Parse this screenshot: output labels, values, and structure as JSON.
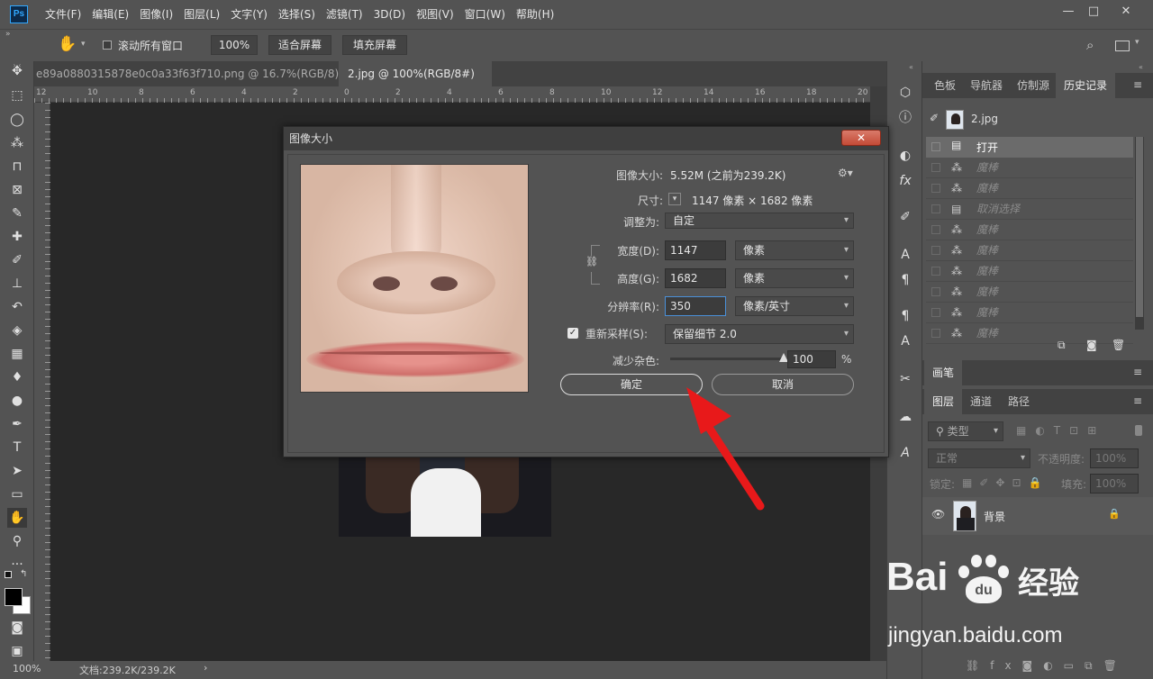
{
  "app": {
    "logo": "Ps"
  },
  "menu": {
    "items": [
      "文件(F)",
      "编辑(E)",
      "图像(I)",
      "图层(L)",
      "文字(Y)",
      "选择(S)",
      "滤镜(T)",
      "3D(D)",
      "视图(V)",
      "窗口(W)",
      "帮助(H)"
    ]
  },
  "window_controls": {
    "minimize": "—",
    "maximize": "□",
    "close": "✕"
  },
  "options": {
    "scroll_all_label": "滚动所有窗口",
    "zoom_label": "100%",
    "fit_screen_label": "适合屏幕",
    "fill_screen_label": "填充屏幕"
  },
  "tabs": [
    {
      "label": "e89a0880315878e0c0a33f63f710.png @ 16.7%(RGB/8) *",
      "close": "✕"
    },
    {
      "label": "2.jpg @ 100%(RGB/8#) *",
      "close": "✕"
    }
  ],
  "ruler_ticks": [
    "12",
    "10",
    "8",
    "6",
    "4",
    "2",
    "0",
    "2",
    "4",
    "6",
    "8",
    "10",
    "12",
    "14",
    "16",
    "18",
    "20"
  ],
  "status": {
    "zoom": "100%",
    "doc": "文档:239.2K/239.2K",
    "arrow": "›"
  },
  "panels": {
    "tabs": [
      "色板",
      "导航器",
      "仿制源",
      "历史记录"
    ],
    "history_snapshot": "2.jpg",
    "history": [
      "打开",
      "魔棒",
      "魔棒",
      "取消选择",
      "魔棒",
      "魔棒",
      "魔棒",
      "魔棒",
      "魔棒",
      "魔棒"
    ],
    "brush_tab": "画笔",
    "layer_tabs": [
      "图层",
      "通道",
      "路径"
    ],
    "layer_kind": "类型",
    "blend_mode": "正常",
    "opacity_label": "不透明度:",
    "opacity_value": "100%",
    "lock_label": "锁定:",
    "fill_label": "填充:",
    "fill_value": "100%",
    "layer_name": "背景"
  },
  "dialog": {
    "title": "图像大小",
    "close": "✕",
    "image_size_label": "图像大小:",
    "image_size_value": "5.52M (之前为239.2K)",
    "dimensions_label": "尺寸:",
    "dimensions_value": "1147 像素  ×  1682 像素",
    "fit_label": "调整为:",
    "fit_value": "自定",
    "width_label": "宽度(D):",
    "width_value": "1147",
    "width_unit": "像素",
    "height_label": "高度(G):",
    "height_value": "1682",
    "height_unit": "像素",
    "resolution_label": "分辨率(R):",
    "resolution_value": "350",
    "resolution_unit": "像素/英寸",
    "resample_label": "重新采样(S):",
    "resample_value": "保留细节 2.0",
    "noise_label": "减少杂色:",
    "noise_value": "100",
    "noise_unit": "%",
    "noise_level": 1.0,
    "ok_label": "确定",
    "cancel_label": "取消"
  },
  "watermark": {
    "brand": "Bai",
    "brand_suffix": "经验",
    "url": "jingyan.baidu.com"
  }
}
